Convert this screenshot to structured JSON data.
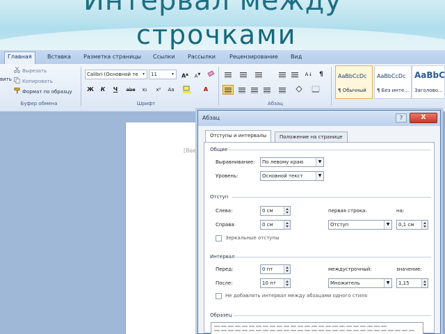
{
  "slide": {
    "title_line1": "Интервал между",
    "title_line2": "строчками"
  },
  "ribbon": {
    "tabs": [
      "Главная",
      "Вставка",
      "Разметка страницы",
      "Ссылки",
      "Рассылки",
      "Рецензирование",
      "Вид"
    ],
    "clipboard": {
      "cut": "Вырезать",
      "copy": "Копировать",
      "format_painter": "Формат по образцу",
      "paste_partial": "вить",
      "group_label": "Буфер обмена"
    },
    "font": {
      "font_name": "Calibri (Основной те",
      "font_size": "11",
      "group_label": "Шрифт",
      "bold": "Ж",
      "italic": "К",
      "underline": "Ч",
      "strike": "abe",
      "subscript": "x₂",
      "superscript": "x²",
      "change_case": "Aa",
      "grow": "A",
      "shrink": "A"
    },
    "paragraph": {
      "group_label": "Абзац"
    },
    "styles": [
      {
        "sample": "AaBbCcDc",
        "name": "¶ Обычный"
      },
      {
        "sample": "AaBbCcDc",
        "name": "¶ Без инте..."
      },
      {
        "sample": "AaBbC",
        "name": "Заголово..."
      }
    ]
  },
  "document": {
    "placeholder": "[Вве"
  },
  "dialog": {
    "title": "Абзац",
    "help": "?",
    "close": "X",
    "tabs": [
      "Отступы и интервалы",
      "Положение на странице"
    ],
    "general": {
      "section": "Общие",
      "alignment_label": "Выравнивание:",
      "alignment_value": "По левому краю",
      "level_label": "Уровень:",
      "level_value": "Основной текст"
    },
    "indent": {
      "section": "Отступ",
      "left_label": "Слева:",
      "left_value": "0 см",
      "right_label": "Справа:",
      "right_value": "0 см",
      "first_line_label": "первая строка:",
      "first_line_value": "Отступ",
      "on_label": "на:",
      "on_value": "0,1 см",
      "mirror_label": "Зеркальные отступы"
    },
    "spacing": {
      "section": "Интервал",
      "before_label": "Перед:",
      "before_value": "0 пт",
      "after_label": "После:",
      "after_value": "10 пт",
      "line_spacing_label": "междустрочный:",
      "line_spacing_value": "Множитель",
      "value_label": "значение:",
      "value_value": "1,15",
      "no_space_label": "Не добавлять интервал между абзацами одного стиля"
    },
    "preview": {
      "section": "Образец"
    }
  }
}
